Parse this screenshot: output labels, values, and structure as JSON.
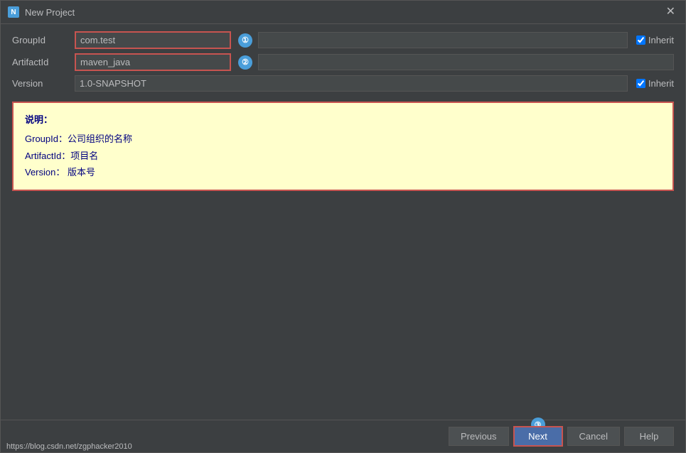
{
  "titleBar": {
    "icon": "N",
    "title": "New Project",
    "closeLabel": "✕"
  },
  "fields": {
    "groupId": {
      "label": "GroupId",
      "value": "com.test",
      "placeholder": "",
      "badge": "①",
      "rightPlaceholder": ""
    },
    "artifactId": {
      "label": "ArtifactId",
      "value": "maven_java",
      "placeholder": "",
      "badge": "②",
      "rightPlaceholder": ""
    },
    "version": {
      "label": "Version",
      "value": "1.0-SNAPSHOT",
      "inheritLabel": "Inherit"
    }
  },
  "description": {
    "title": "说明：",
    "lines": [
      "GroupId：公司组织的名称",
      "ArtifactId：项目名",
      "Version： 版本号"
    ]
  },
  "footer": {
    "previousLabel": "Previous",
    "nextLabel": "Next",
    "cancelLabel": "Cancel",
    "helpLabel": "Help",
    "url": "https://blog.csdn.net/zgphacker2010",
    "nextBadge": "③"
  },
  "inherit": {
    "groupIdInherit": true,
    "versionInherit": true
  }
}
